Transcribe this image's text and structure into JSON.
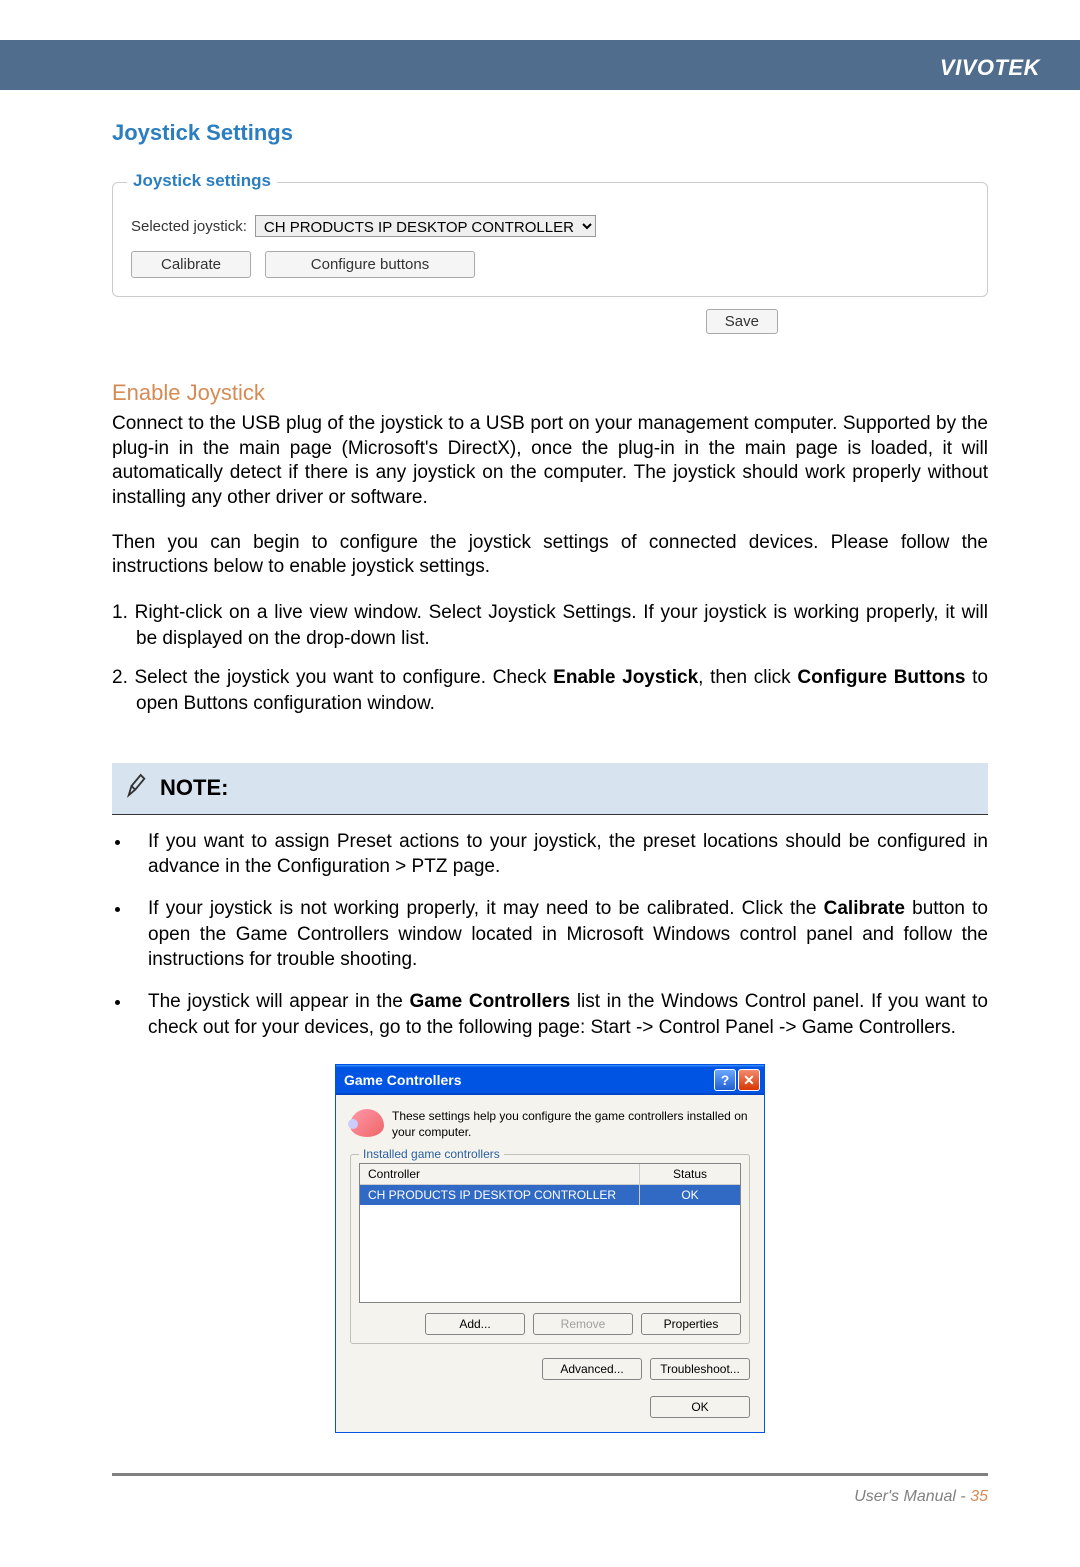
{
  "brand": "VIVOTEK",
  "section_title": "Joystick Settings",
  "fieldset": {
    "legend": "Joystick settings",
    "label": "Selected joystick:",
    "selected": "CH PRODUCTS IP DESKTOP CONTROLLER",
    "btn_calibrate": "Calibrate",
    "btn_configure": "Configure buttons"
  },
  "save_label": "Save",
  "enable_title": "Enable Joystick",
  "para1": "Connect to the USB plug of the joystick to a USB port on your management computer. Supported by the plug-in in the main page (Microsoft's DirectX), once the plug-in in the main page is loaded, it will automatically detect if there is any joystick on the computer. The joystick should work properly without installing any other driver or software.",
  "para2": "Then you can begin to configure the joystick settings of connected devices. Please follow the instructions below to enable joystick settings.",
  "step1": "1. Right-click on a live view window. Select Joystick Settings. If your joystick is working properly, it will be displayed on the drop-down list.",
  "step2_pre": "2. Select the joystick you want to configure. Check ",
  "step2_b1": "Enable Joystick",
  "step2_mid": ", then click ",
  "step2_b2": "Configure Buttons",
  "step2_post": " to open Buttons configuration window.",
  "note_title": "NOTE:",
  "bullet1": "If you want to assign Preset actions to your joystick, the preset locations should be configured in advance in the Configuration > PTZ page.",
  "bullet2_pre": "If your joystick is not working properly, it may need to be calibrated. Click the ",
  "bullet2_b": "Calibrate",
  "bullet2_post": " button to open the Game Controllers window located in Microsoft Windows control panel and follow the instructions for trouble shooting.",
  "bullet3_pre": "The joystick will appear in the ",
  "bullet3_b": "Game Controllers",
  "bullet3_post": " list in the Windows Control panel. If you want to check out for your devices, go to the following page: Start -> Control Panel -> Game Controllers.",
  "xpdialog": {
    "title": "Game Controllers",
    "desc": "These settings help you configure the game controllers installed on your computer.",
    "legend": "Installed game controllers",
    "col_controller": "Controller",
    "col_status": "Status",
    "row_controller": "CH PRODUCTS IP DESKTOP CONTROLLER",
    "row_status": "OK",
    "btn_add": "Add...",
    "btn_remove": "Remove",
    "btn_properties": "Properties",
    "btn_advanced": "Advanced...",
    "btn_troubleshoot": "Troubleshoot...",
    "btn_ok": "OK"
  },
  "footer_text": "User's Manual - ",
  "footer_page": "35"
}
